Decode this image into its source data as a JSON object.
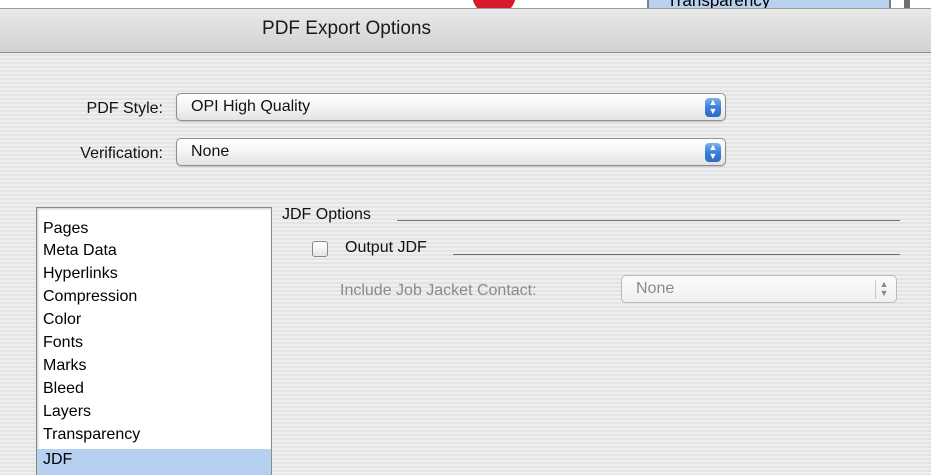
{
  "background": {
    "list_fragment_text": "Transparency"
  },
  "dialog": {
    "title": "PDF Export Options",
    "pdf_style": {
      "label": "PDF Style:",
      "value": "OPI High Quality"
    },
    "verification": {
      "label": "Verification:",
      "value": "None"
    },
    "panels": [
      {
        "label": "Pages"
      },
      {
        "label": "Meta Data"
      },
      {
        "label": "Hyperlinks"
      },
      {
        "label": "Compression"
      },
      {
        "label": "Color"
      },
      {
        "label": "Fonts"
      },
      {
        "label": "Marks"
      },
      {
        "label": "Bleed"
      },
      {
        "label": "Layers"
      },
      {
        "label": "Transparency"
      },
      {
        "label": "JDF",
        "selected": true
      }
    ],
    "jdf": {
      "section_title": "JDF Options",
      "output_jdf_label": "Output JDF",
      "output_jdf_checked": false,
      "contact_label": "Include Job Jacket Contact:",
      "contact_value": "None"
    }
  },
  "colors": {
    "selection": "#b6d0f0",
    "popup_arrow": "#3a7fdb",
    "background_red": "#d8182b"
  }
}
